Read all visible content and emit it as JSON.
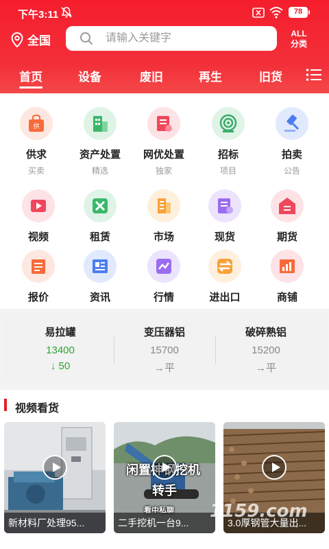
{
  "status": {
    "time": "下午3:11",
    "battery": "78"
  },
  "header": {
    "location": "全国",
    "search_placeholder": "请输入关键字",
    "all_line1": "ALL",
    "all_line2": "分类"
  },
  "tabs": [
    "首页",
    "设备",
    "废旧",
    "再生",
    "旧货"
  ],
  "categories": [
    {
      "label": "供求",
      "sub": "买卖",
      "icon": "supply-bag-icon",
      "color": "#f86a3a"
    },
    {
      "label": "资产处置",
      "sub": "精选",
      "icon": "building-icon",
      "color": "#3cb86b"
    },
    {
      "label": "网优处置",
      "sub": "独家",
      "icon": "receipt-icon",
      "color": "#f0475a"
    },
    {
      "label": "招标",
      "sub": "项目",
      "icon": "target-icon",
      "color": "#3aab6a"
    },
    {
      "label": "拍卖",
      "sub": "公告",
      "icon": "gavel-icon",
      "color": "#4c7df0"
    },
    {
      "label": "视频",
      "icon": "video-icon",
      "color": "#f0475a"
    },
    {
      "label": "租赁",
      "icon": "tools-icon",
      "color": "#3cb86b"
    },
    {
      "label": "市场",
      "icon": "market-icon",
      "color": "#f8a23a"
    },
    {
      "label": "现货",
      "icon": "spot-goods-icon",
      "color": "#9a6cf0"
    },
    {
      "label": "期货",
      "icon": "futures-icon",
      "color": "#f0475a"
    },
    {
      "label": "报价",
      "icon": "quote-icon",
      "color": "#f86a3a"
    },
    {
      "label": "资讯",
      "icon": "news-icon",
      "color": "#4c7df0"
    },
    {
      "label": "行情",
      "icon": "trend-icon",
      "color": "#9a6cf0"
    },
    {
      "label": "进出口",
      "icon": "exchange-icon",
      "color": "#f8a23a"
    },
    {
      "label": "商铺",
      "icon": "shop-icon",
      "color": "#f0475a"
    }
  ],
  "prices": [
    {
      "name": "易拉罐",
      "value": "13400",
      "change": "↓ 50",
      "trend": "down"
    },
    {
      "name": "变压器铝",
      "value": "15700",
      "change": "→平",
      "trend": "flat"
    },
    {
      "name": "破碎熟铝",
      "value": "15200",
      "change": "→平",
      "trend": "flat"
    }
  ],
  "section": {
    "title": "视频看货"
  },
  "videos": [
    {
      "caption": "新材料厂处理95...",
      "overlay": ""
    },
    {
      "caption": "二手挖机一台9...",
      "overlay": "闲置神钢挖机 转手",
      "overlay_small": "看中私聊"
    },
    {
      "caption": "3.0厚钢管大量出...",
      "overlay": ""
    }
  ],
  "watermark": "1159.com"
}
